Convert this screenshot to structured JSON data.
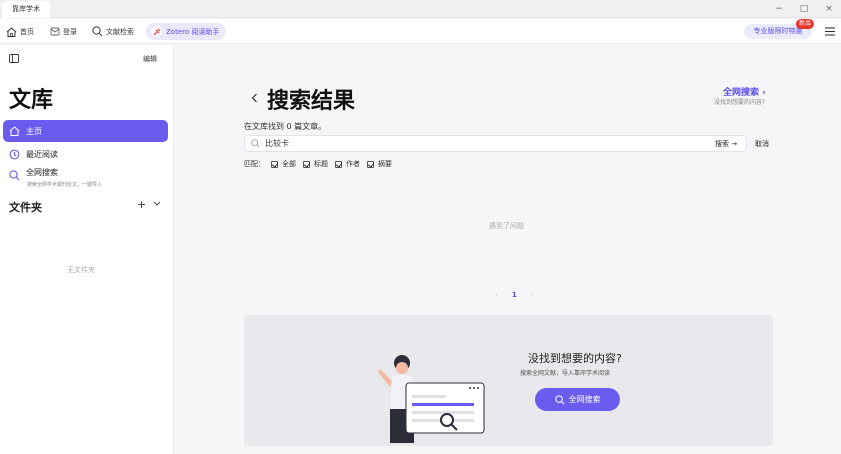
{
  "window": {
    "tab_title": "靠岸学术",
    "controls": {
      "minimize": "−",
      "maximize": "□",
      "close": "×"
    }
  },
  "toolbar": {
    "home": "首页",
    "login": "登录",
    "lit_search": "文献检索",
    "zotero": "Zotero 阅读助手",
    "pro": "专业版限时特惠",
    "new_badge": "新品"
  },
  "sidebar": {
    "edit": "编辑",
    "title": "文库",
    "items": [
      {
        "label": "主页",
        "icon": "home-icon",
        "active": true
      },
      {
        "label": "最近阅读",
        "icon": "clock-icon",
        "active": false
      },
      {
        "label": "全网搜索",
        "icon": "search-icon",
        "active": false,
        "sub": "搜索全网学术期刊论文，一键导入"
      }
    ],
    "folders_title": "文件夹",
    "folder_add": "+",
    "no_folders": "无文件夹"
  },
  "main": {
    "back": "‹",
    "title": "搜索结果",
    "web_search": "全网搜索 ›",
    "web_search_sub": "没找到想要的内容?",
    "found_text": "在文库找到 0 篇文章。",
    "search_value": "比较卡",
    "search_go": "搜索 →",
    "cancel": "取消",
    "match_label": "匹配：",
    "match_options": [
      "全部",
      "标题",
      "作者",
      "摘要"
    ],
    "problem": "遇到了问题",
    "pager": {
      "prev": "‹",
      "current": "1",
      "next": "›"
    }
  },
  "promo": {
    "title": "没找到想要的内容?",
    "subtitle": "搜索全网文献，导入靠岸学术阅读",
    "button": "全网搜索"
  },
  "colors": {
    "accent": "#6b5cf0",
    "badge": "#e6352b"
  }
}
